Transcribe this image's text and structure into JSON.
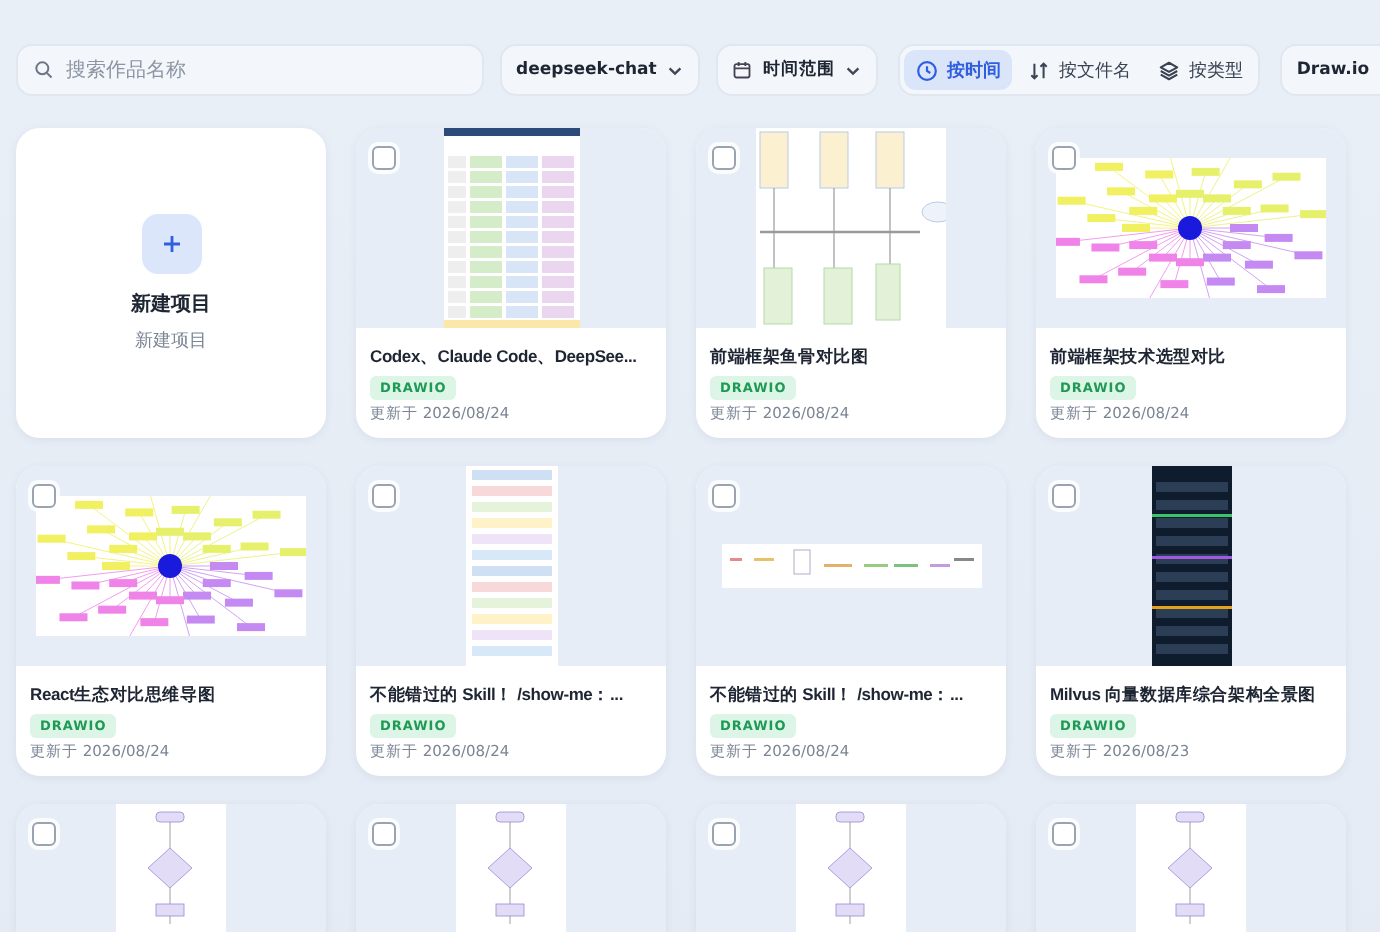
{
  "toolbar": {
    "search": {
      "placeholder": "搜索作品名称"
    },
    "model_select": {
      "value": "deepseek-chat"
    },
    "time_range": {
      "label": "时间范围"
    },
    "sort_options": [
      {
        "label": "按时间",
        "kind": "time",
        "selected": true
      },
      {
        "label": "按文件名",
        "kind": "name",
        "selected": false
      },
      {
        "label": "按类型",
        "kind": "type",
        "selected": false
      }
    ],
    "format_select": {
      "value": "Draw.io"
    }
  },
  "new_project": {
    "title": "新建项目",
    "subtitle": "新建项目"
  },
  "projects": [
    {
      "kind": "table",
      "selected": false,
      "title": "Codex、Claude Code、DeepSee...",
      "badge": "DRAWIO",
      "updated": "更新于 2026/08/24"
    },
    {
      "kind": "fishbone",
      "selected": false,
      "title": "前端框架鱼骨对比图",
      "badge": "DRAWIO",
      "updated": "更新于 2026/08/24"
    },
    {
      "kind": "mindmap",
      "selected": false,
      "title": "前端框架技术选型对比",
      "badge": "DRAWIO",
      "updated": "更新于 2026/08/24"
    },
    {
      "kind": "mindmap",
      "selected": false,
      "title": "React生态对比思维导图",
      "badge": "DRAWIO",
      "updated": "更新于 2026/08/24"
    },
    {
      "kind": "document",
      "selected": false,
      "title": "不能错过的 Skill！ /show-me：...",
      "badge": "DRAWIO",
      "updated": "更新于 2026/08/24"
    },
    {
      "kind": "timeline",
      "selected": false,
      "title": "不能错过的 Skill！ /show-me：...",
      "badge": "DRAWIO",
      "updated": "更新于 2026/08/24"
    },
    {
      "kind": "dark-panel",
      "selected": false,
      "title": "Milvus 向量数据库综合架构全景图",
      "badge": "DRAWIO",
      "updated": "更新于 2026/08/23"
    },
    {
      "kind": "flowchart",
      "selected": false
    },
    {
      "kind": "flowchart",
      "selected": false
    },
    {
      "kind": "flowchart",
      "selected": false
    },
    {
      "kind": "flowchart",
      "selected": false
    }
  ]
}
